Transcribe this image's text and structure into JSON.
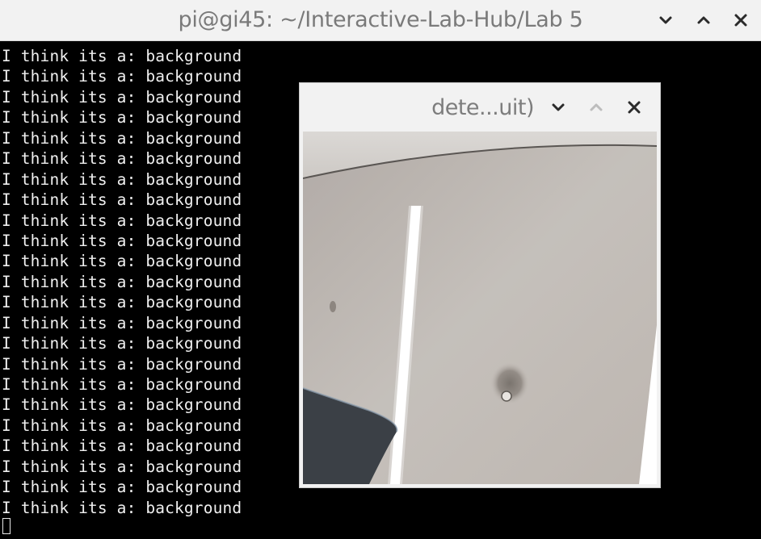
{
  "terminal": {
    "title": "pi@gi45: ~/Interactive-Lab-Hub/Lab 5",
    "lines": [
      "I think its a: background",
      "I think its a: background",
      "I think its a: background",
      "I think its a: background",
      "I think its a: background",
      "I think its a: background",
      "I think its a: background",
      "I think its a: background",
      "I think its a: background",
      "I think its a: background",
      "I think its a: background",
      "I think its a: background",
      "I think its a: background",
      "I think its a: background",
      "I think its a: background",
      "I think its a: background",
      "I think its a: background",
      "I think its a: background",
      "I think its a: background",
      "I think its a: background",
      "I think its a: background",
      "I think its a: background",
      "I think its a: background"
    ],
    "controls": {
      "minimize_icon": "chevron-down-icon",
      "maximize_icon": "chevron-up-icon",
      "close_icon": "close-icon"
    }
  },
  "camera_window": {
    "title": "dete...uit)",
    "controls": {
      "minimize_icon": "chevron-down-icon",
      "maximize_icon": "chevron-up-icon",
      "close_icon": "close-icon"
    }
  },
  "colors": {
    "titlebar_bg": "#f2f2f2",
    "title_text": "#7a7a7a",
    "terminal_bg": "#000000",
    "terminal_text": "#f0f0f0",
    "icon": "#2b2b2b",
    "icon_disabled": "#bdbdbd"
  }
}
